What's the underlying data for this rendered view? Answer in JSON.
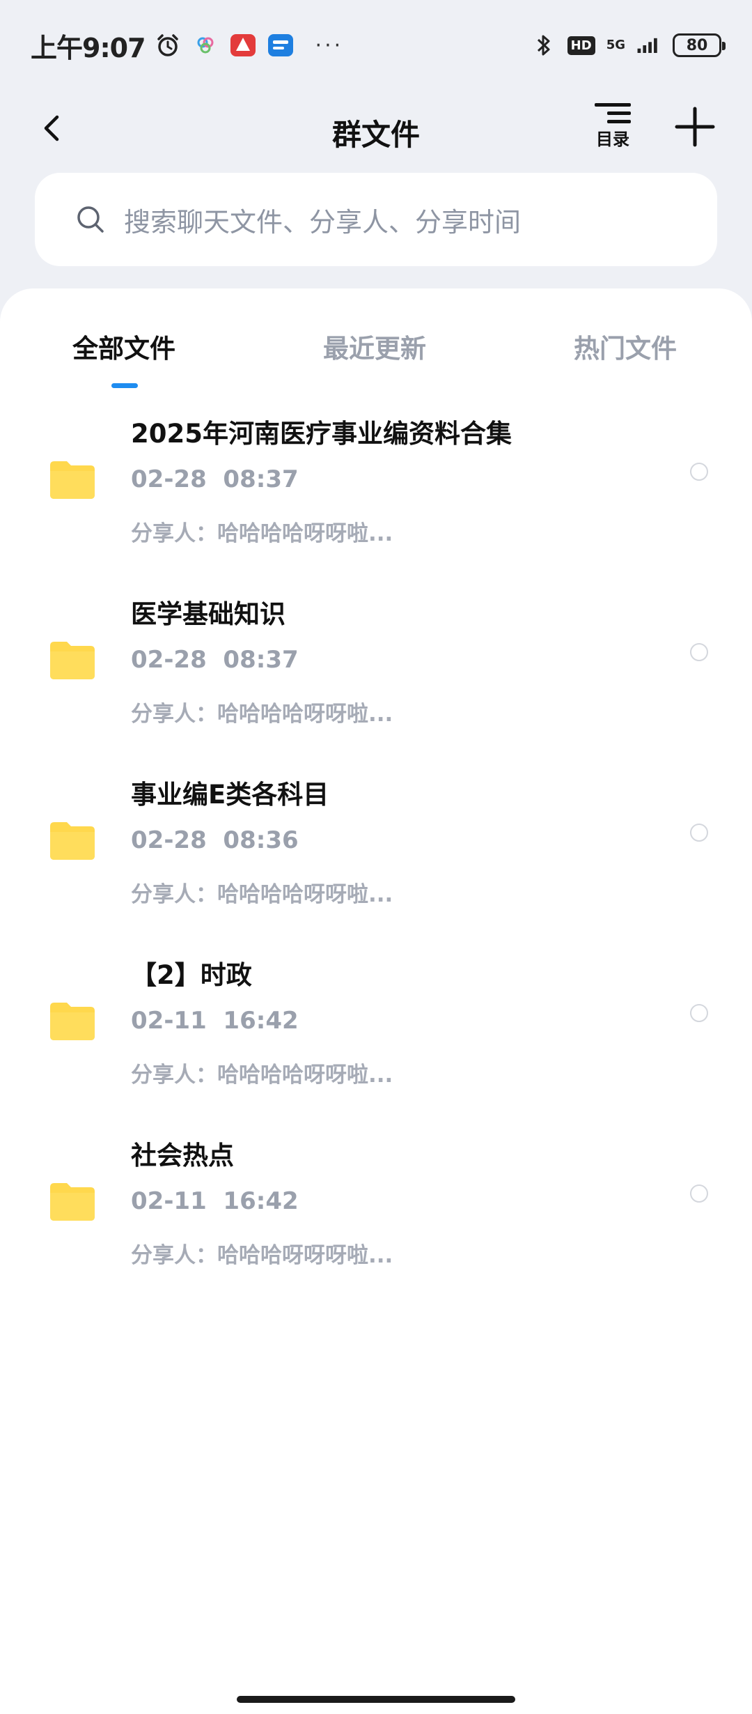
{
  "status_bar": {
    "time": "上午9:07",
    "more": "···",
    "hd": "HD",
    "network": "5G",
    "battery": "80"
  },
  "nav": {
    "title": "群文件",
    "toc_label": "目录"
  },
  "search": {
    "placeholder": "搜索聊天文件、分享人、分享时间"
  },
  "tabs": [
    {
      "label": "全部文件",
      "active": true
    },
    {
      "label": "最近更新",
      "active": false
    },
    {
      "label": "热门文件",
      "active": false
    }
  ],
  "files": [
    {
      "name": "2025年河南医疗事业编资料合集",
      "date": "02-28  08:37",
      "sharer": "分享人：哈哈哈哈呀呀啦..."
    },
    {
      "name": "医学基础知识",
      "date": "02-28  08:37",
      "sharer": "分享人：哈哈哈哈呀呀啦..."
    },
    {
      "name": "事业编E类各科目",
      "date": "02-28  08:36",
      "sharer": "分享人：哈哈哈哈呀呀啦..."
    },
    {
      "name": "【2】时政",
      "date": "02-11  16:42",
      "sharer": "分享人：哈哈哈哈呀呀啦..."
    },
    {
      "name": "社会热点",
      "date": "02-11  16:42",
      "sharer": "分享人：哈哈哈呀呀呀啦..."
    }
  ],
  "colors": {
    "accent": "#1e8cf0",
    "folder": "#ffd84d",
    "background": "#eef0f5"
  }
}
